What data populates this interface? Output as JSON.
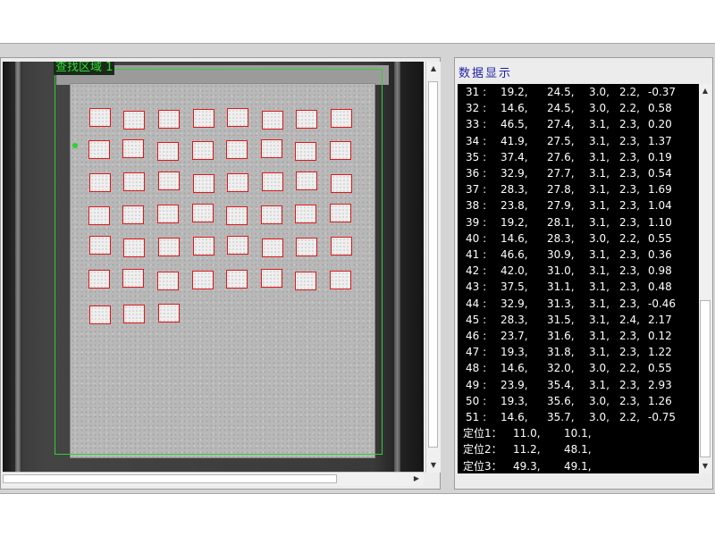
{
  "image_panel": {
    "search_region_label": "查找区域 1",
    "grid": {
      "rows": 7,
      "columns": 8,
      "last_row_count": 3
    }
  },
  "data_panel": {
    "title": "数据显示",
    "rows": [
      {
        "id": "31 :",
        "x": "19.2,",
        "y": "24.5,",
        "w": "3.0,",
        "h": "2.2,",
        "v": "-0.37"
      },
      {
        "id": "32 :",
        "x": "14.6,",
        "y": "24.5,",
        "w": "3.0,",
        "h": "2.2,",
        "v": "0.58"
      },
      {
        "id": "33 :",
        "x": "46.5,",
        "y": "27.4,",
        "w": "3.1,",
        "h": "2.3,",
        "v": "0.20"
      },
      {
        "id": "34 :",
        "x": "41.9,",
        "y": "27.5,",
        "w": "3.1,",
        "h": "2.3,",
        "v": "1.37"
      },
      {
        "id": "35 :",
        "x": "37.4,",
        "y": "27.6,",
        "w": "3.1,",
        "h": "2.3,",
        "v": "0.19"
      },
      {
        "id": "36 :",
        "x": "32.9,",
        "y": "27.7,",
        "w": "3.1,",
        "h": "2.3,",
        "v": "0.54"
      },
      {
        "id": "37 :",
        "x": "28.3,",
        "y": "27.8,",
        "w": "3.1,",
        "h": "2.3,",
        "v": "1.69"
      },
      {
        "id": "38 :",
        "x": "23.8,",
        "y": "27.9,",
        "w": "3.1,",
        "h": "2.3,",
        "v": "1.04"
      },
      {
        "id": "39 :",
        "x": "19.2,",
        "y": "28.1,",
        "w": "3.1,",
        "h": "2.3,",
        "v": "1.10"
      },
      {
        "id": "40 :",
        "x": "14.6,",
        "y": "28.3,",
        "w": "3.0,",
        "h": "2.2,",
        "v": "0.55"
      },
      {
        "id": "41 :",
        "x": "46.6,",
        "y": "30.9,",
        "w": "3.1,",
        "h": "2.3,",
        "v": "0.36"
      },
      {
        "id": "42 :",
        "x": "42.0,",
        "y": "31.0,",
        "w": "3.1,",
        "h": "2.3,",
        "v": "0.98"
      },
      {
        "id": "43 :",
        "x": "37.5,",
        "y": "31.1,",
        "w": "3.1,",
        "h": "2.3,",
        "v": "0.48"
      },
      {
        "id": "44 :",
        "x": "32.9,",
        "y": "31.3,",
        "w": "3.1,",
        "h": "2.3,",
        "v": "-0.46"
      },
      {
        "id": "45 :",
        "x": "28.3,",
        "y": "31.5,",
        "w": "3.1,",
        "h": "2.4,",
        "v": "2.17"
      },
      {
        "id": "46 :",
        "x": "23.7,",
        "y": "31.6,",
        "w": "3.1,",
        "h": "2.3,",
        "v": "0.12"
      },
      {
        "id": "47 :",
        "x": "19.3,",
        "y": "31.8,",
        "w": "3.1,",
        "h": "2.3,",
        "v": "1.22"
      },
      {
        "id": "48 :",
        "x": "14.6,",
        "y": "32.0,",
        "w": "3.0,",
        "h": "2.2,",
        "v": "0.55"
      },
      {
        "id": "49 :",
        "x": "23.9,",
        "y": "35.4,",
        "w": "3.1,",
        "h": "2.3,",
        "v": "2.93"
      },
      {
        "id": "50 :",
        "x": "19.3,",
        "y": "35.6,",
        "w": "3.0,",
        "h": "2.3,",
        "v": "1.26"
      },
      {
        "id": "51 :",
        "x": "14.6,",
        "y": "35.7,",
        "w": "3.0,",
        "h": "2.2,",
        "v": "-0.75"
      }
    ],
    "positions": [
      {
        "label": "定位1：",
        "x": "11.0,",
        "y": "10.1,"
      },
      {
        "label": "定位2：",
        "x": "11.2,",
        "y": "48.1,"
      },
      {
        "label": "定位3：",
        "x": "49.3,",
        "y": "49.1,"
      }
    ]
  },
  "scroll_arrows": {
    "up": "▲",
    "down": "▼",
    "left": "◀",
    "right": "▶"
  },
  "colors": {
    "roi_line": "#30d030",
    "cell_outline": "#e01818",
    "data_background": "#000000",
    "data_text": "#ffffff",
    "title_text": "#1e1eaa"
  }
}
